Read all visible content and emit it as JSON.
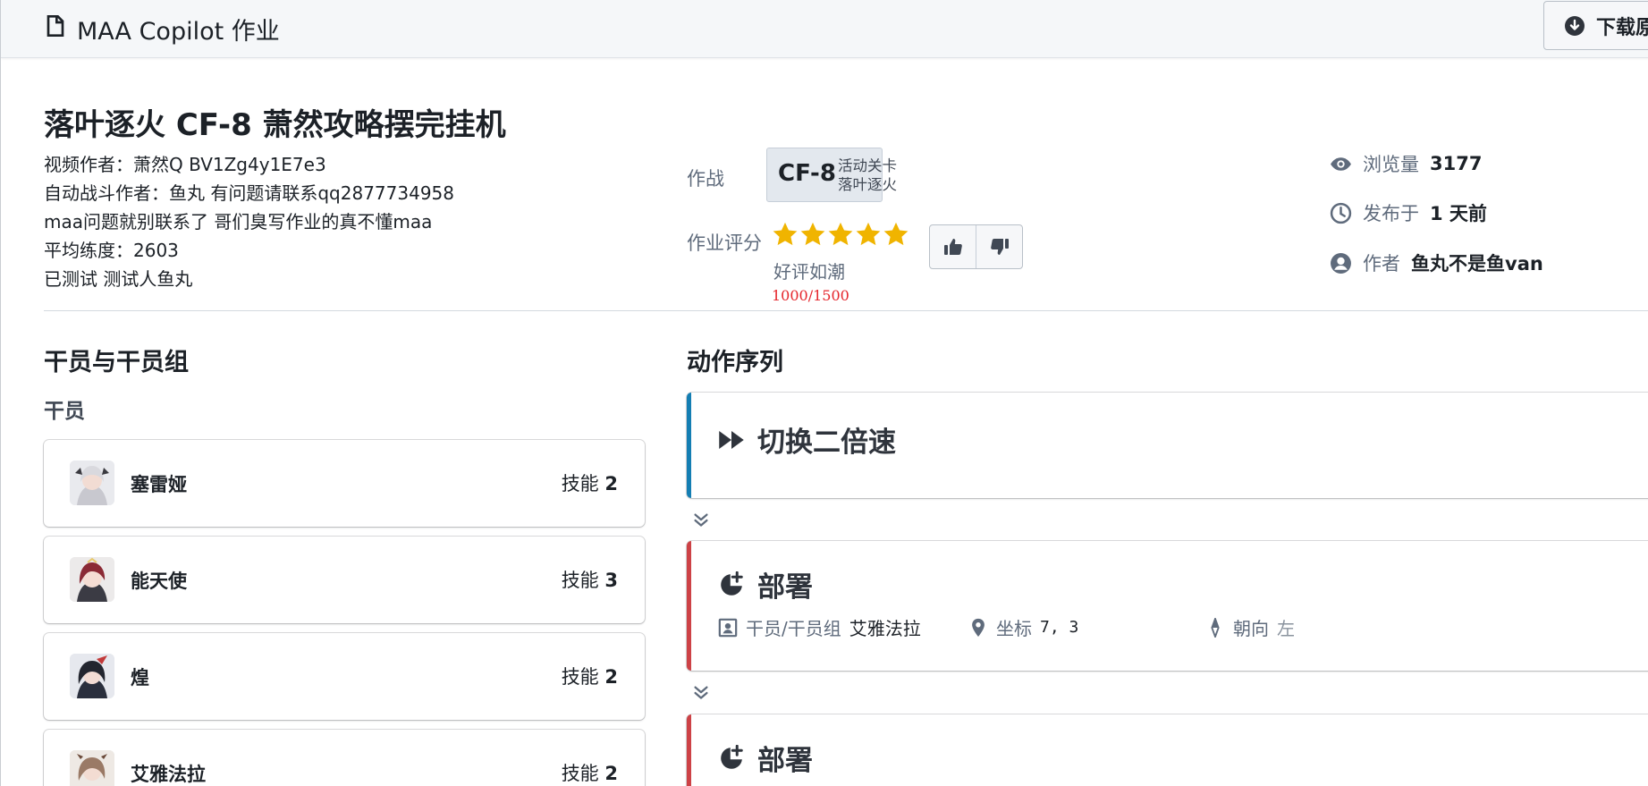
{
  "header": {
    "title": "MAA Copilot 作业",
    "download_label": "下载原"
  },
  "work": {
    "title": "落叶逐火 CF-8 萧然攻略摆完挂机",
    "desc": [
      "视频作者：萧然Q BV1Zg4y1E7e3",
      "自动战斗作者：鱼丸 有问题请联系qq2877734958",
      "maa问题就别联系了 哥们臭写作业的真不懂maa",
      "平均练度：2603",
      "已测试 测试人鱼丸"
    ]
  },
  "stage": {
    "label": "作战",
    "code": "CF-8",
    "type": "活动关卡",
    "name": "落叶逐火"
  },
  "rating": {
    "label": "作业评分",
    "stars": 5,
    "text": "好评如潮",
    "count": "1000/1500",
    "star_color": "#f0b400"
  },
  "meta": {
    "views_label": "浏览量",
    "views": "3177",
    "published_label": "发布于",
    "published": "1 天前",
    "author_label": "作者",
    "author": "鱼丸不是鱼van"
  },
  "operators_section": {
    "title": "干员与干员组",
    "subtitle": "干员",
    "skill_label": "技能",
    "items": [
      {
        "name": "塞雷娅",
        "skill": "2"
      },
      {
        "name": "能天使",
        "skill": "3"
      },
      {
        "name": "煌",
        "skill": "2"
      },
      {
        "name": "艾雅法拉",
        "skill": "2"
      }
    ]
  },
  "actions_section": {
    "title": "动作序列",
    "items": [
      {
        "title": "切换二倍速",
        "accent": "#147eb3"
      },
      {
        "title": "部署",
        "accent": "#cd4246",
        "op_label": "干员/干员组",
        "op": "艾雅法拉",
        "coord_label": "坐标",
        "coord": "7, 3",
        "dir_label": "朝向",
        "dir": "左"
      },
      {
        "title": "部署",
        "accent": "#cd4246"
      }
    ]
  }
}
